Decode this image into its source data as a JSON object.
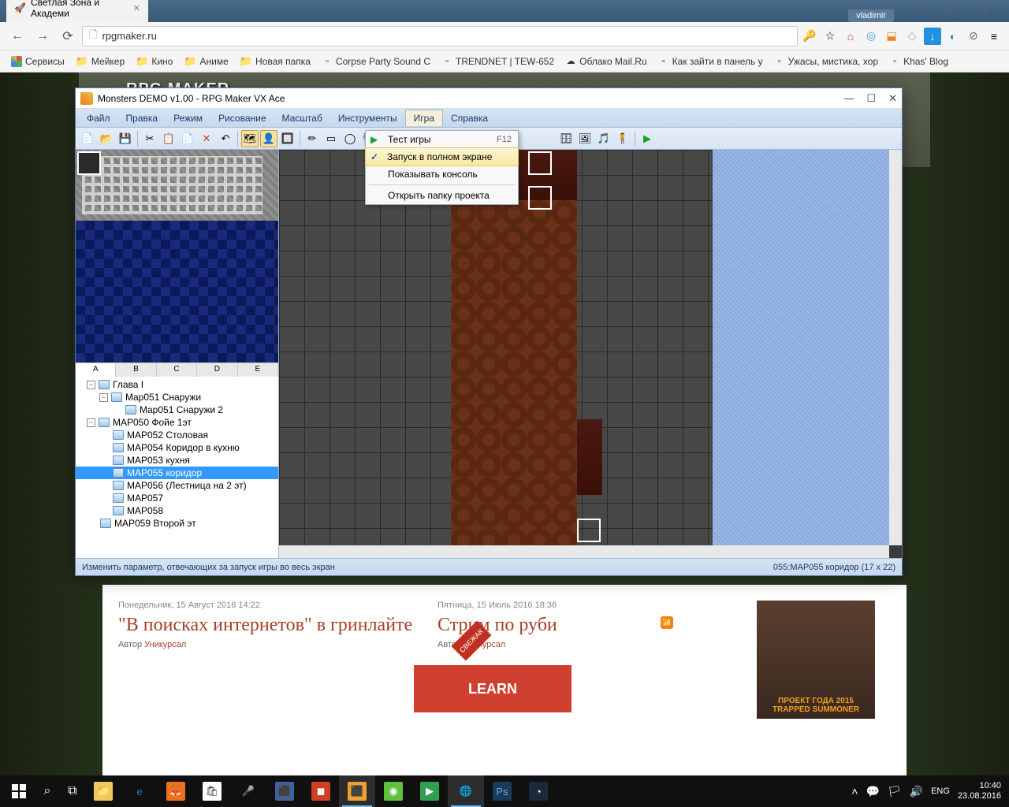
{
  "chrome": {
    "tab_title": "Светлая Зона и Академи",
    "user_badge": "vladimir",
    "url": "rpgmaker.ru",
    "bookmarks": [
      {
        "icon": "grid",
        "label": "Сервисы"
      },
      {
        "icon": "folder",
        "label": "Мейкер"
      },
      {
        "icon": "folder",
        "label": "Кино"
      },
      {
        "icon": "folder",
        "label": "Аниме"
      },
      {
        "icon": "folder",
        "label": "Новая папка"
      },
      {
        "icon": "page",
        "label": "Corpse Party Sound C"
      },
      {
        "icon": "page",
        "label": "TRENDNET | TEW-652"
      },
      {
        "icon": "cloud",
        "label": "Облако Mail.Ru"
      },
      {
        "icon": "page",
        "label": "Как зайти в панель у"
      },
      {
        "icon": "page",
        "label": "Ужасы, мистика, хор"
      },
      {
        "icon": "page",
        "label": "Khas' Blog"
      }
    ]
  },
  "page": {
    "logo": "RPG MAKER",
    "article1": {
      "date": "Понедельник, 15 Август 2016 14:22",
      "title": "\"В поисках интернетов\" в гринлайте",
      "author_label": "Автор",
      "author": "Уникурсал"
    },
    "article2": {
      "date": "Пятница, 15 Июль 2016 18:36",
      "title": "Стрим по руби",
      "author_label": "Автор",
      "author": "Уникурсал"
    },
    "badge_new": "СВЕЖАК",
    "ad_line1": "ПРОЕКТ ГОДА 2015",
    "ad_line2": "TRAPPED SUMMONER",
    "learn": "LEARN"
  },
  "rpgmaker": {
    "title": "Monsters DEMO v1.00 - RPG Maker VX Ace",
    "menu": [
      "Файл",
      "Правка",
      "Режим",
      "Рисование",
      "Масштаб",
      "Инструменты",
      "Игра",
      "Справка"
    ],
    "menu_active_index": 6,
    "dropdown": [
      {
        "label": "Тест игры",
        "shortcut": "F12",
        "icon": "play"
      },
      {
        "label": "Запуск в полном экране",
        "checked": true,
        "highlighted": true
      },
      {
        "label": "Показывать консоль"
      },
      {
        "sep": true
      },
      {
        "label": "Открыть папку проекта"
      }
    ],
    "tileset_tabs": [
      "A",
      "B",
      "C",
      "D",
      "E"
    ],
    "tileset_active_tab": 0,
    "tree": [
      {
        "depth": 0,
        "toggle": "-",
        "label": "Глава I"
      },
      {
        "depth": 1,
        "toggle": "-",
        "label": "Map051 Снаружи"
      },
      {
        "depth": 2,
        "label": "Map051 Снаружи 2"
      },
      {
        "depth": 0,
        "toggle": "-",
        "label": "MAP050 Фойе 1эт"
      },
      {
        "depth": 1,
        "label": "MAP052 Столовая"
      },
      {
        "depth": 1,
        "label": "MAP054 Коридор в кухню"
      },
      {
        "depth": 1,
        "label": "MAP053 кухня"
      },
      {
        "depth": 1,
        "label": "MAP055 коридор",
        "selected": true
      },
      {
        "depth": 1,
        "label": "MAP056 (Лестница на 2 эт)"
      },
      {
        "depth": 1,
        "label": "MAP057"
      },
      {
        "depth": 1,
        "label": "MAP058"
      },
      {
        "depth": 0,
        "label": "MAP059 Второй эт"
      }
    ],
    "status_left": "Изменить параметр, отвечающих за запуск игры во весь экран",
    "status_right": "055:MAP055 коридор (17 x 22)"
  },
  "taskbar": {
    "tray_lang": "ENG",
    "time": "10:40",
    "date": "23.08.2016"
  }
}
